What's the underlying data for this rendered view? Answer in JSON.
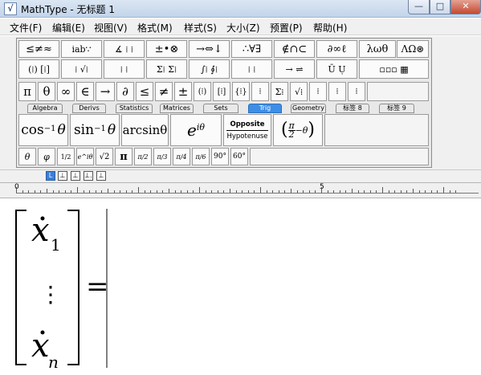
{
  "window": {
    "app_name": "MathType",
    "title": "MathType - 无标题 1",
    "min_symbol": "—",
    "max_symbol": "□",
    "close_symbol": "✕"
  },
  "menu": [
    {
      "label": "文件(F)"
    },
    {
      "label": "编辑(E)"
    },
    {
      "label": "视图(V)"
    },
    {
      "label": "格式(M)"
    },
    {
      "label": "样式(S)"
    },
    {
      "label": "大小(Z)"
    },
    {
      "label": "预置(P)"
    },
    {
      "label": "帮助(H)"
    }
  ],
  "symbol_row_1": [
    "≤≠≈",
    "ⅰab∵",
    "∡ ⁞ ⁞",
    "±•⊗",
    "→⇔↓",
    "∴∀∃",
    "∉∩⊂",
    "∂∞ℓ",
    "λωθ",
    "ΛΩ⊛"
  ],
  "template_row_1": [
    "(⁞) [⁞]",
    "⁞ √⁞",
    "⁞ ⁞",
    "Σ⁞ Σ⁞",
    "∫⁞ ∮⁞",
    "⁞ ⁞",
    "→ ⇌",
    "Ū Ụ",
    "▫▫▫ ▦"
  ],
  "small_row": [
    "π",
    "θ",
    "∞",
    "∈",
    "→",
    "∂",
    "≤",
    "≠",
    "±",
    "(⁞)",
    "[⁞]",
    "{⁞}",
    "⁞",
    "Σ⁞",
    "√⁞",
    "⁞",
    "⁞",
    "⁞"
  ],
  "tabs": [
    {
      "label": "Algebra"
    },
    {
      "label": "Derivs"
    },
    {
      "label": "Statistics"
    },
    {
      "label": "Matrices"
    },
    {
      "label": "Sets"
    },
    {
      "label": "Trig"
    },
    {
      "label": "Geometry"
    },
    {
      "label": "标签 8"
    },
    {
      "label": "标签 9"
    }
  ],
  "active_tab": "Trig",
  "trig_templates": {
    "cos_label": "cos",
    "sin_label": "sin",
    "inverse_exp": "−1",
    "theta": "θ",
    "arcsin_label": "arcsinθ",
    "exp_base": "e",
    "exp_power": "iθ",
    "opposite": "Opposite",
    "hypotenuse": "Hypotenuse",
    "pi_over_two": "π",
    "two": "2",
    "minus_theta": "−θ"
  },
  "bottom_row": [
    "θ",
    "φ",
    "1/2",
    "e^iθ",
    "√2",
    "π",
    "π/2",
    "π/3",
    "π/4",
    "π/6",
    "90°",
    "60°"
  ],
  "ruler": {
    "mark_0": "0",
    "mark_5": "5"
  },
  "ruler_tab_buttons": [
    "L",
    "⊥",
    "⊥",
    "⊥.",
    "⊥"
  ],
  "equation": {
    "var": "x",
    "sub_first": "1",
    "sub_last": "n",
    "vdots": "⋮",
    "equals": "="
  }
}
